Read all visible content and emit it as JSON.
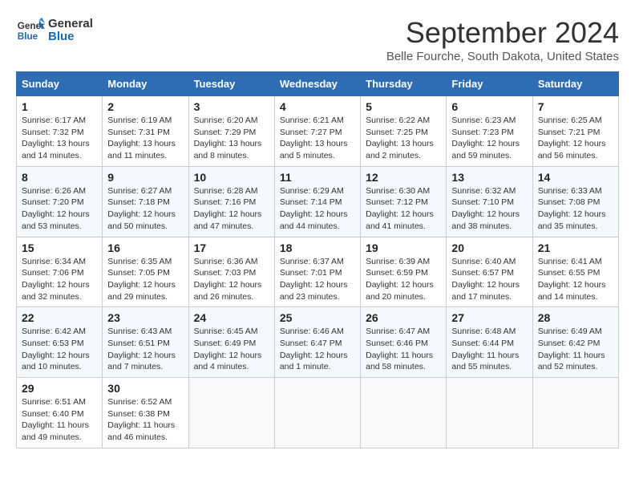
{
  "header": {
    "logo_line1": "General",
    "logo_line2": "Blue",
    "month": "September 2024",
    "location": "Belle Fourche, South Dakota, United States"
  },
  "weekdays": [
    "Sunday",
    "Monday",
    "Tuesday",
    "Wednesday",
    "Thursday",
    "Friday",
    "Saturday"
  ],
  "weeks": [
    [
      {
        "day": "1",
        "info": "Sunrise: 6:17 AM\nSunset: 7:32 PM\nDaylight: 13 hours\nand 14 minutes."
      },
      {
        "day": "2",
        "info": "Sunrise: 6:19 AM\nSunset: 7:31 PM\nDaylight: 13 hours\nand 11 minutes."
      },
      {
        "day": "3",
        "info": "Sunrise: 6:20 AM\nSunset: 7:29 PM\nDaylight: 13 hours\nand 8 minutes."
      },
      {
        "day": "4",
        "info": "Sunrise: 6:21 AM\nSunset: 7:27 PM\nDaylight: 13 hours\nand 5 minutes."
      },
      {
        "day": "5",
        "info": "Sunrise: 6:22 AM\nSunset: 7:25 PM\nDaylight: 13 hours\nand 2 minutes."
      },
      {
        "day": "6",
        "info": "Sunrise: 6:23 AM\nSunset: 7:23 PM\nDaylight: 12 hours\nand 59 minutes."
      },
      {
        "day": "7",
        "info": "Sunrise: 6:25 AM\nSunset: 7:21 PM\nDaylight: 12 hours\nand 56 minutes."
      }
    ],
    [
      {
        "day": "8",
        "info": "Sunrise: 6:26 AM\nSunset: 7:20 PM\nDaylight: 12 hours\nand 53 minutes."
      },
      {
        "day": "9",
        "info": "Sunrise: 6:27 AM\nSunset: 7:18 PM\nDaylight: 12 hours\nand 50 minutes."
      },
      {
        "day": "10",
        "info": "Sunrise: 6:28 AM\nSunset: 7:16 PM\nDaylight: 12 hours\nand 47 minutes."
      },
      {
        "day": "11",
        "info": "Sunrise: 6:29 AM\nSunset: 7:14 PM\nDaylight: 12 hours\nand 44 minutes."
      },
      {
        "day": "12",
        "info": "Sunrise: 6:30 AM\nSunset: 7:12 PM\nDaylight: 12 hours\nand 41 minutes."
      },
      {
        "day": "13",
        "info": "Sunrise: 6:32 AM\nSunset: 7:10 PM\nDaylight: 12 hours\nand 38 minutes."
      },
      {
        "day": "14",
        "info": "Sunrise: 6:33 AM\nSunset: 7:08 PM\nDaylight: 12 hours\nand 35 minutes."
      }
    ],
    [
      {
        "day": "15",
        "info": "Sunrise: 6:34 AM\nSunset: 7:06 PM\nDaylight: 12 hours\nand 32 minutes."
      },
      {
        "day": "16",
        "info": "Sunrise: 6:35 AM\nSunset: 7:05 PM\nDaylight: 12 hours\nand 29 minutes."
      },
      {
        "day": "17",
        "info": "Sunrise: 6:36 AM\nSunset: 7:03 PM\nDaylight: 12 hours\nand 26 minutes."
      },
      {
        "day": "18",
        "info": "Sunrise: 6:37 AM\nSunset: 7:01 PM\nDaylight: 12 hours\nand 23 minutes."
      },
      {
        "day": "19",
        "info": "Sunrise: 6:39 AM\nSunset: 6:59 PM\nDaylight: 12 hours\nand 20 minutes."
      },
      {
        "day": "20",
        "info": "Sunrise: 6:40 AM\nSunset: 6:57 PM\nDaylight: 12 hours\nand 17 minutes."
      },
      {
        "day": "21",
        "info": "Sunrise: 6:41 AM\nSunset: 6:55 PM\nDaylight: 12 hours\nand 14 minutes."
      }
    ],
    [
      {
        "day": "22",
        "info": "Sunrise: 6:42 AM\nSunset: 6:53 PM\nDaylight: 12 hours\nand 10 minutes."
      },
      {
        "day": "23",
        "info": "Sunrise: 6:43 AM\nSunset: 6:51 PM\nDaylight: 12 hours\nand 7 minutes."
      },
      {
        "day": "24",
        "info": "Sunrise: 6:45 AM\nSunset: 6:49 PM\nDaylight: 12 hours\nand 4 minutes."
      },
      {
        "day": "25",
        "info": "Sunrise: 6:46 AM\nSunset: 6:47 PM\nDaylight: 12 hours\nand 1 minute."
      },
      {
        "day": "26",
        "info": "Sunrise: 6:47 AM\nSunset: 6:46 PM\nDaylight: 11 hours\nand 58 minutes."
      },
      {
        "day": "27",
        "info": "Sunrise: 6:48 AM\nSunset: 6:44 PM\nDaylight: 11 hours\nand 55 minutes."
      },
      {
        "day": "28",
        "info": "Sunrise: 6:49 AM\nSunset: 6:42 PM\nDaylight: 11 hours\nand 52 minutes."
      }
    ],
    [
      {
        "day": "29",
        "info": "Sunrise: 6:51 AM\nSunset: 6:40 PM\nDaylight: 11 hours\nand 49 minutes."
      },
      {
        "day": "30",
        "info": "Sunrise: 6:52 AM\nSunset: 6:38 PM\nDaylight: 11 hours\nand 46 minutes."
      },
      {
        "day": "",
        "info": ""
      },
      {
        "day": "",
        "info": ""
      },
      {
        "day": "",
        "info": ""
      },
      {
        "day": "",
        "info": ""
      },
      {
        "day": "",
        "info": ""
      }
    ]
  ]
}
